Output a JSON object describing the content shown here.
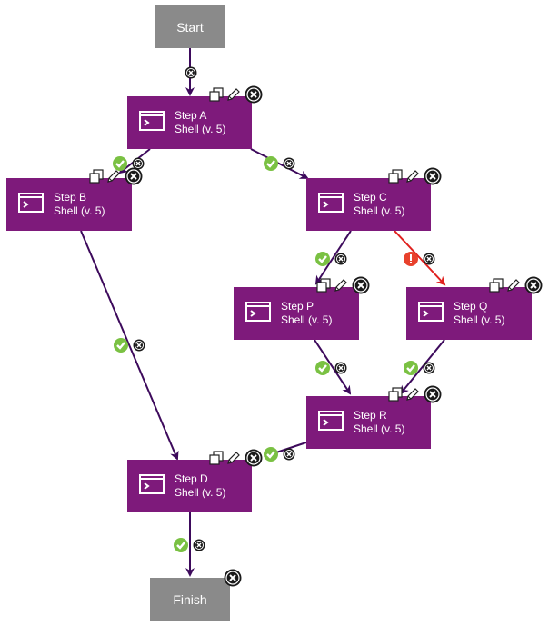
{
  "colors": {
    "step_fill": "#7e1a7b",
    "terminal_fill": "#8a8a8a",
    "edge": "#3d0a5c",
    "edge_error": "#e0201e",
    "success_badge": "#7ac143",
    "error_badge": "#e8412c",
    "delete_badge": "#1a1a1a"
  },
  "nodes": {
    "start": {
      "label": "Start"
    },
    "finish": {
      "label": "Finish"
    },
    "a": {
      "title": "Step A",
      "subtitle": "Shell (v. 5)"
    },
    "b": {
      "title": "Step B",
      "subtitle": "Shell (v. 5)"
    },
    "c": {
      "title": "Step C",
      "subtitle": "Shell (v. 5)"
    },
    "p": {
      "title": "Step P",
      "subtitle": "Shell (v. 5)"
    },
    "q": {
      "title": "Step Q",
      "subtitle": "Shell (v. 5)"
    },
    "r": {
      "title": "Step R",
      "subtitle": "Shell (v. 5)"
    },
    "d": {
      "title": "Step D",
      "subtitle": "Shell (v. 5)"
    }
  },
  "step_actions": [
    "copy",
    "edit",
    "delete"
  ],
  "edges": [
    {
      "from": "start",
      "to": "a",
      "condition": "none"
    },
    {
      "from": "a",
      "to": "b",
      "condition": "success"
    },
    {
      "from": "a",
      "to": "c",
      "condition": "success"
    },
    {
      "from": "b",
      "to": "d",
      "condition": "success"
    },
    {
      "from": "c",
      "to": "p",
      "condition": "success"
    },
    {
      "from": "c",
      "to": "q",
      "condition": "failure"
    },
    {
      "from": "p",
      "to": "r",
      "condition": "success"
    },
    {
      "from": "q",
      "to": "r",
      "condition": "success"
    },
    {
      "from": "r",
      "to": "d",
      "condition": "success"
    },
    {
      "from": "d",
      "to": "finish",
      "condition": "success"
    }
  ]
}
